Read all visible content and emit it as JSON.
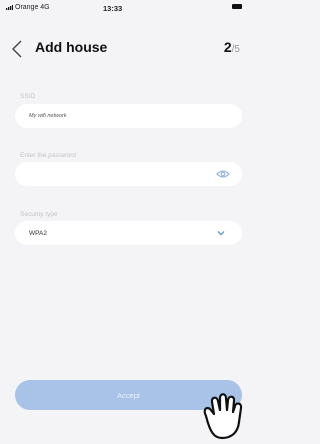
{
  "status_bar": {
    "carrier": "Orange 4G",
    "time": "13:33"
  },
  "header": {
    "title": "Add house",
    "step_current": "2",
    "step_total": "/5"
  },
  "form": {
    "ssid": {
      "label": "SSID",
      "value": "My wifi network"
    },
    "password": {
      "label": "Enter the password",
      "value": ""
    },
    "security": {
      "label": "Security type",
      "value": "WPA2"
    }
  },
  "accept_label": "Accept",
  "colors": {
    "accent": "#4a8ad8",
    "button": "#a8c2e8",
    "background": "#f4f4f6"
  },
  "icons": [
    "signal-icon",
    "battery-icon",
    "back-chevron-icon",
    "eye-icon",
    "chevron-down-icon",
    "hand-pointer-icon"
  ]
}
